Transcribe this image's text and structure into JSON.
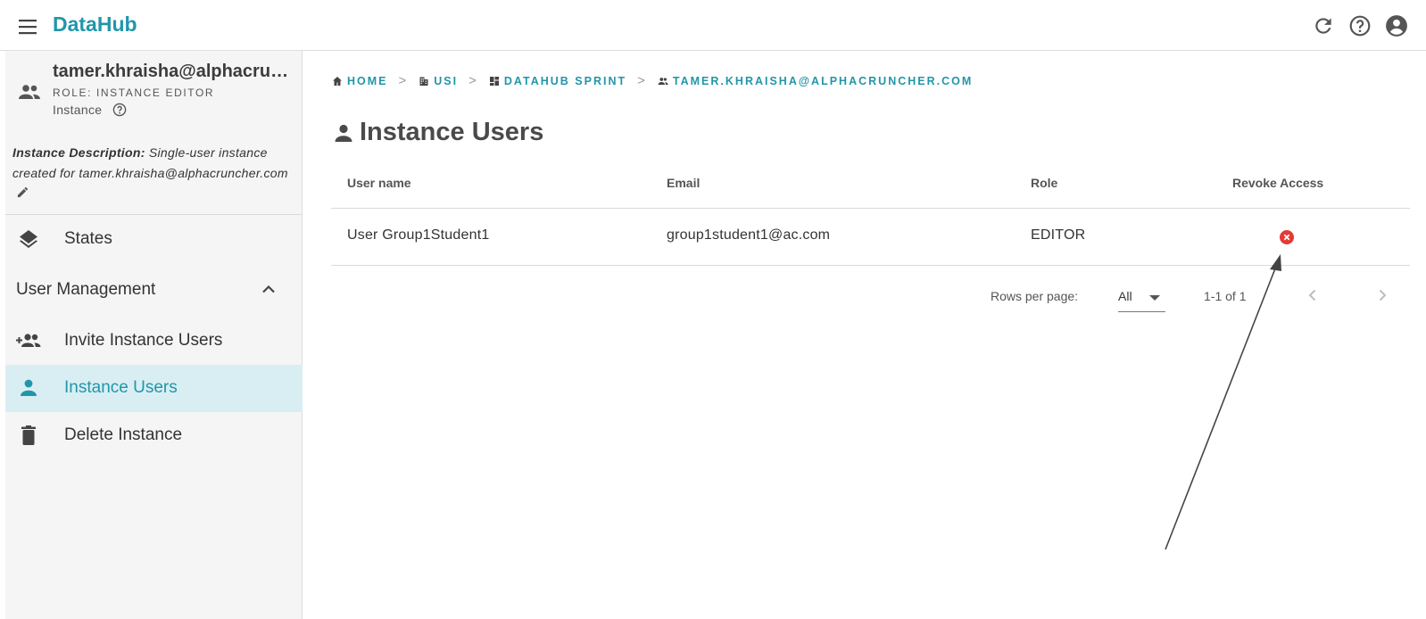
{
  "app": {
    "title": "DataHub",
    "icons": [
      "menu-icon",
      "refresh-icon",
      "help-icon",
      "account-icon"
    ]
  },
  "sidebar": {
    "user": "tamer.khraisha@alphacrun...",
    "role": "ROLE: INSTANCE EDITOR",
    "type": "Instance",
    "description_label": "Instance Description:",
    "description_text": " Single-user instance created for tamer.khraisha@alphacruncher.com",
    "items": [
      {
        "label": "States",
        "icon": "layers-icon"
      },
      {
        "label": "User Management",
        "icon": "chevron-up-icon"
      },
      {
        "label": "Invite Instance Users",
        "icon": "group-add-icon"
      },
      {
        "label": "Instance Users",
        "icon": "person-icon",
        "active": true
      },
      {
        "label": "Delete Instance",
        "icon": "trash-icon"
      }
    ]
  },
  "breadcrumb": [
    {
      "label": "HOME",
      "icon": "home-icon"
    },
    {
      "label": "USI",
      "icon": "building-icon"
    },
    {
      "label": "DATAHUB SPRINT",
      "icon": "dashboard-icon"
    },
    {
      "label": "TAMER.KHRAISHA@ALPHACRUNCHER.COM",
      "icon": "people-icon"
    }
  ],
  "breadcrumb_separator": ">",
  "page": {
    "title": "Instance Users"
  },
  "table": {
    "headers": [
      "User name",
      "Email",
      "Role",
      "Revoke Access"
    ],
    "rows": [
      {
        "username": "User Group1Student1",
        "email": "group1student1@ac.com",
        "role": "EDITOR"
      }
    ]
  },
  "pagination": {
    "rows_per_page_label": "Rows per page:",
    "rows_per_page_value": "All",
    "range": "1-1 of 1"
  },
  "colors": {
    "accent": "#2196aa",
    "active_bg": "#d9eef3",
    "revoke": "#e53935"
  }
}
